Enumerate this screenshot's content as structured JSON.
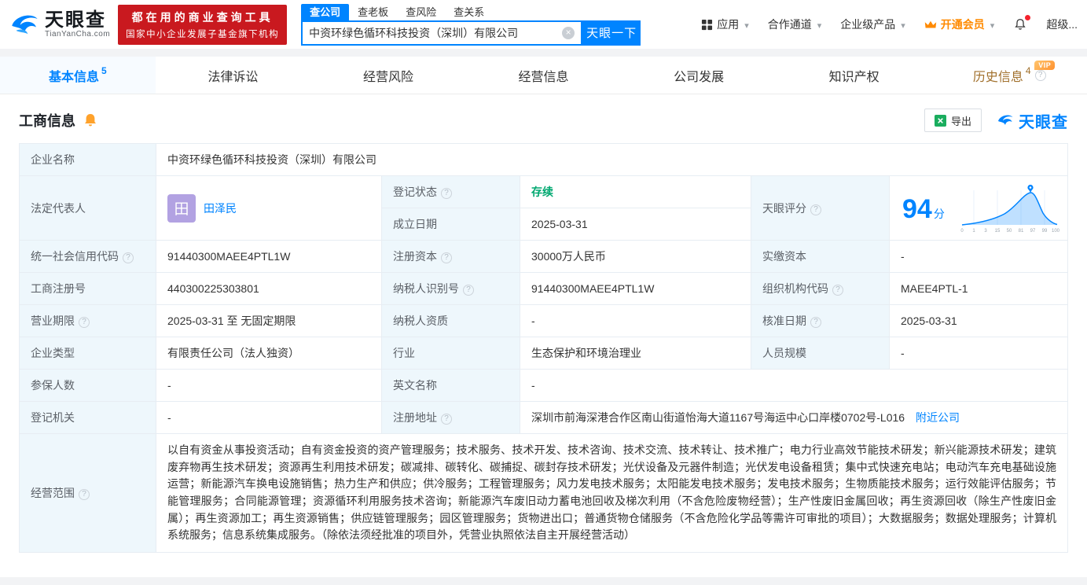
{
  "brand": {
    "name_cn": "天眼查",
    "domain": "TianYanCha.com",
    "promo_line1": "都在用的商业查询工具",
    "promo_line2": "国家中小企业发展子基金旗下机构"
  },
  "search": {
    "tabs": [
      {
        "label": "查公司"
      },
      {
        "label": "查老板"
      },
      {
        "label": "查风险"
      },
      {
        "label": "查关系"
      }
    ],
    "value": "中资环绿色循环科技投资（深圳）有限公司",
    "button_label": "天眼一下"
  },
  "top_nav": {
    "apps": "应用",
    "cooperation": "合作通道",
    "enterprise": "企业级产品",
    "upgrade_vip": "开通会员",
    "super_vip": "超级..."
  },
  "page_tabs": {
    "basic": {
      "label": "基本信息",
      "count": "5"
    },
    "legal": {
      "label": "法律诉讼"
    },
    "risk": {
      "label": "经营风险"
    },
    "operating": {
      "label": "经营信息"
    },
    "development": {
      "label": "公司发展"
    },
    "ip": {
      "label": "知识产权"
    },
    "history": {
      "label": "历史信息",
      "count": "4",
      "badge": "VIP"
    }
  },
  "section": {
    "title": "工商信息",
    "export_label": "导出",
    "brand_mark": "天眼查"
  },
  "score": {
    "label": "天眼评分",
    "value": "94",
    "unit": "分",
    "ticks": [
      "0",
      "1",
      "3",
      "15",
      "50",
      "81",
      "97",
      "99",
      "100"
    ]
  },
  "fields": {
    "company_name": {
      "label": "企业名称",
      "value": "中资环绿色循环科技投资（深圳）有限公司"
    },
    "legal_rep": {
      "label": "法定代表人",
      "value": "田泽民",
      "avatar": "田"
    },
    "reg_status": {
      "label": "登记状态",
      "value": "存续"
    },
    "establish_date": {
      "label": "成立日期",
      "value": "2025-03-31"
    },
    "credit_code": {
      "label": "统一社会信用代码",
      "value": "91440300MAEE4PTL1W"
    },
    "reg_capital": {
      "label": "注册资本",
      "value": "30000万人民币"
    },
    "paid_capital": {
      "label": "实缴资本",
      "value": "-"
    },
    "reg_number": {
      "label": "工商注册号",
      "value": "440300225303801"
    },
    "taxpayer_id": {
      "label": "纳税人识别号",
      "value": "91440300MAEE4PTL1W"
    },
    "org_code": {
      "label": "组织机构代码",
      "value": "MAEE4PTL-1"
    },
    "business_term": {
      "label": "营业期限",
      "value": "2025-03-31 至 无固定期限"
    },
    "taxpayer_quality": {
      "label": "纳税人资质",
      "value": "-"
    },
    "approval_date": {
      "label": "核准日期",
      "value": "2025-03-31"
    },
    "company_type": {
      "label": "企业类型",
      "value": "有限责任公司（法人独资）"
    },
    "industry": {
      "label": "行业",
      "value": "生态保护和环境治理业"
    },
    "staff_size": {
      "label": "人员规模",
      "value": "-"
    },
    "insured_count": {
      "label": "参保人数",
      "value": "-"
    },
    "english_name": {
      "label": "英文名称",
      "value": "-"
    },
    "reg_authority": {
      "label": "登记机关",
      "value": "-"
    },
    "reg_address": {
      "label": "注册地址",
      "value": "深圳市前海深港合作区南山街道怡海大道1167号海运中心口岸楼0702号-L016",
      "link": "附近公司"
    },
    "business_scope": {
      "label": "经营范围",
      "value": "以自有资金从事投资活动；自有资金投资的资产管理服务；技术服务、技术开发、技术咨询、技术交流、技术转让、技术推广；电力行业高效节能技术研发；新兴能源技术研发；建筑废弃物再生技术研发；资源再生利用技术研发；碳减排、碳转化、碳捕捉、碳封存技术研发；光伏设备及元器件制造；光伏发电设备租赁；集中式快速充电站；电动汽车充电基础设施运营；新能源汽车换电设施销售；热力生产和供应；供冷服务；工程管理服务；风力发电技术服务；太阳能发电技术服务；发电技术服务；生物质能技术服务；运行效能评估服务；节能管理服务；合同能源管理；资源循环利用服务技术咨询；新能源汽车废旧动力蓄电池回收及梯次利用（不含危险废物经营）；生产性废旧金属回收；再生资源回收（除生产性废旧金属）；再生资源加工；再生资源销售；供应链管理服务；园区管理服务；货物进出口；普通货物仓储服务（不含危险化学品等需许可审批的项目）；大数据服务；数据处理服务；计算机系统服务；信息系统集成服务。（除依法须经批准的项目外，凭营业执照依法自主开展经营活动）"
    }
  },
  "colors": {
    "brand_blue": "#0084ff",
    "promo_red": "#c9191f",
    "vip_orange": "#ff8a00",
    "status_green": "#00a870",
    "history_gold": "#a1702c"
  }
}
